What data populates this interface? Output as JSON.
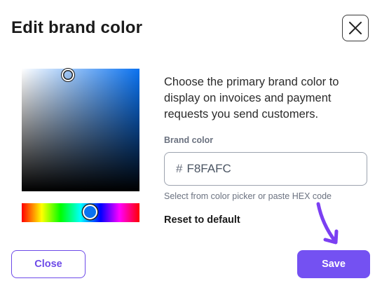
{
  "dialog": {
    "title": "Edit brand color",
    "close_icon": "close-icon"
  },
  "picker": {
    "selected_color": "#0A72F0",
    "square_base_color": "#0A72F0"
  },
  "content": {
    "description": "Choose the primary brand color to display on invoices and payment requests you send customers.",
    "field_label": "Brand color",
    "hash_symbol": "#",
    "hex_value": "F8FAFC",
    "helper_text": "Select from color picker or paste HEX code",
    "reset_label": "Reset to default"
  },
  "footer": {
    "close_label": "Close",
    "save_label": "Save"
  },
  "colors": {
    "accent": "#7451F2",
    "annotation_arrow": "#7B3FF2"
  }
}
